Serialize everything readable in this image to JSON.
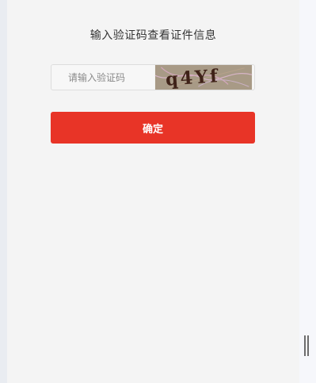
{
  "page": {
    "title": "输入验证码查看证件信息"
  },
  "form": {
    "captcha_input_value": "",
    "captcha_placeholder": "请输入验证码",
    "captcha_image_text": "q4Yf",
    "confirm_label": "确定"
  },
  "colors": {
    "primary_button": "#e83427",
    "card_background": "#f4f4f4",
    "page_background": "#e9ecf1",
    "captcha_background": "#a89a86"
  },
  "icons": {
    "resize_handle": "resize-handle-icon"
  }
}
